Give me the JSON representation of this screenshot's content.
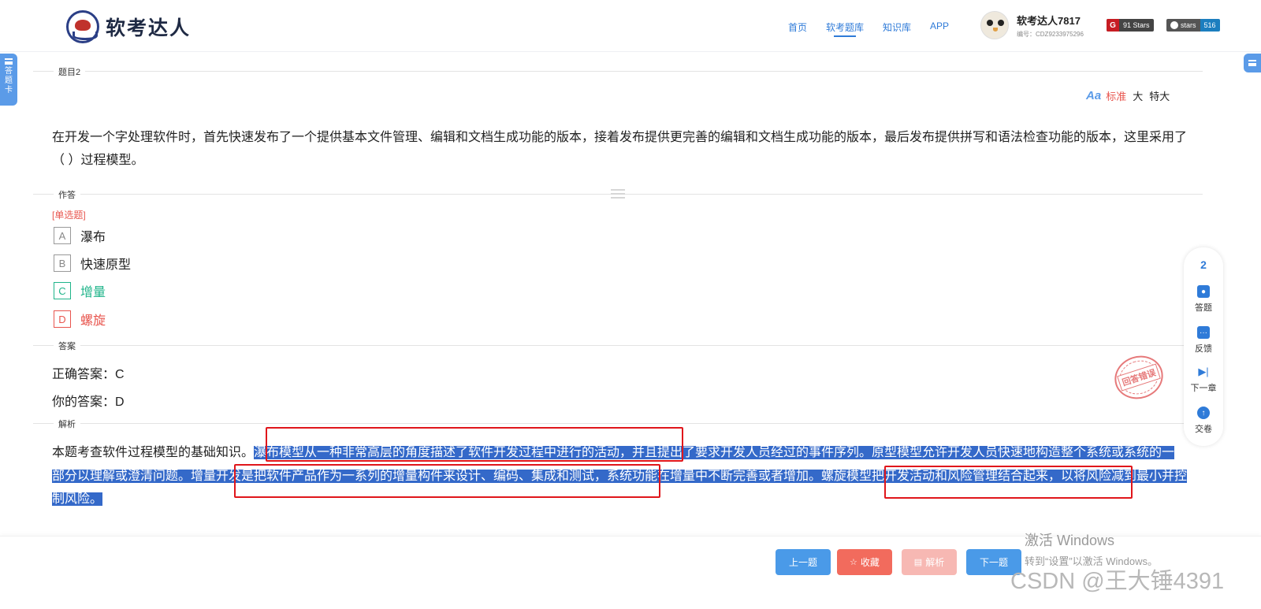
{
  "header": {
    "logo_text": "软考达人",
    "nav": [
      "首页",
      "软考题库",
      "知识库",
      "APP"
    ],
    "nav_active_index": 1,
    "user_name": "软考达人7817",
    "user_id": "编号：CDZ9233975296",
    "badge_gitee": "91 Stars",
    "badge_github_label": "stars",
    "badge_github_count": "516"
  },
  "side_tab": {
    "label_1": "答",
    "label_2": "题",
    "label_3": "卡"
  },
  "sections": {
    "question": "题目2",
    "answer_area": "作答",
    "answer": "答案",
    "analysis": "解析"
  },
  "font_size": {
    "standard": "标准",
    "large": "大",
    "xlarge": "特大",
    "active": "standard"
  },
  "question_text": "在开发一个字处理软件时，首先快速发布了一个提供基本文件管理、编辑和文档生成功能的版本，接着发布提供更完善的编辑和文档生成功能的版本，最后发布提供拼写和语法检查功能的版本，这里采用了（ ）过程模型。",
  "question_type": "[单选题]",
  "options": [
    {
      "key": "A",
      "text": "瀑布",
      "state": "normal"
    },
    {
      "key": "B",
      "text": "快速原型",
      "state": "normal"
    },
    {
      "key": "C",
      "text": "增量",
      "state": "correct"
    },
    {
      "key": "D",
      "text": "螺旋",
      "state": "wrong"
    }
  ],
  "answer": {
    "correct": "正确答案：C",
    "yours": "你的答案：D",
    "stamp": "回答错误"
  },
  "analysis": {
    "intro": "本题考查软件过程模型的基础知识。",
    "highlighted": "瀑布模型从一种非常高层的角度描述了软件开发过程中进行的活动，并且提出了要求开发人员经过的事件序列。原型模型允许开发人员快速地构造整个系统或系统的一部分以理解或澄清问题。增量开发是把软件产品作为一系列的增量构件来设计、编码、集成和测试，系统功能在增量中不断完善或者增加。螺旋模型把开发活动和风险管理结合起来，以将风险减到最小并控制风险。"
  },
  "float_bar": {
    "number": "2",
    "items": [
      "答题",
      "反馈",
      "下一章",
      "交卷"
    ]
  },
  "bottom_buttons": {
    "prev": "上一题",
    "fav": "收藏",
    "analysis": "解析",
    "next": "下一题"
  },
  "watermarks": {
    "windows_1": "激活 Windows",
    "windows_2": "转到“设置”以激活 Windows。",
    "csdn": "CSDN @王大锤4391"
  }
}
